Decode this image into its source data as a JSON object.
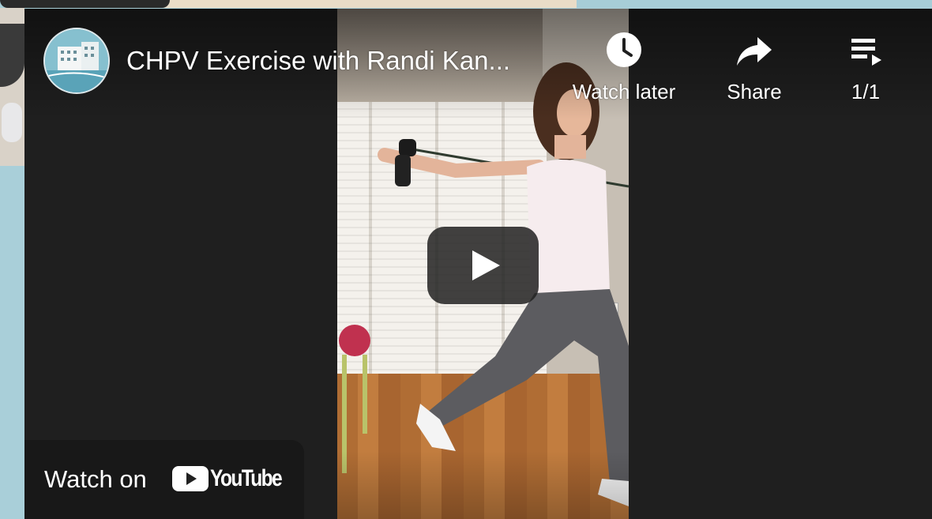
{
  "video": {
    "title": "CHPV Exercise with Randi Kan...",
    "channel_avatar_alt": "channel-avatar"
  },
  "actions": {
    "watch_later": {
      "label": "Watch later",
      "icon": "clock-icon"
    },
    "share": {
      "label": "Share",
      "icon": "share-arrow-icon"
    },
    "playlist": {
      "label": "1/1",
      "icon": "playlist-icon"
    }
  },
  "watch_on": {
    "text": "Watch on",
    "brand": "YouTube",
    "icon": "youtube-play-icon"
  },
  "play_button": {
    "icon": "play-icon"
  },
  "colors": {
    "page_background": "#a9cfd9",
    "player_background": "#1f1f1f",
    "text": "#ffffff",
    "play_button_bg": "#212121"
  }
}
